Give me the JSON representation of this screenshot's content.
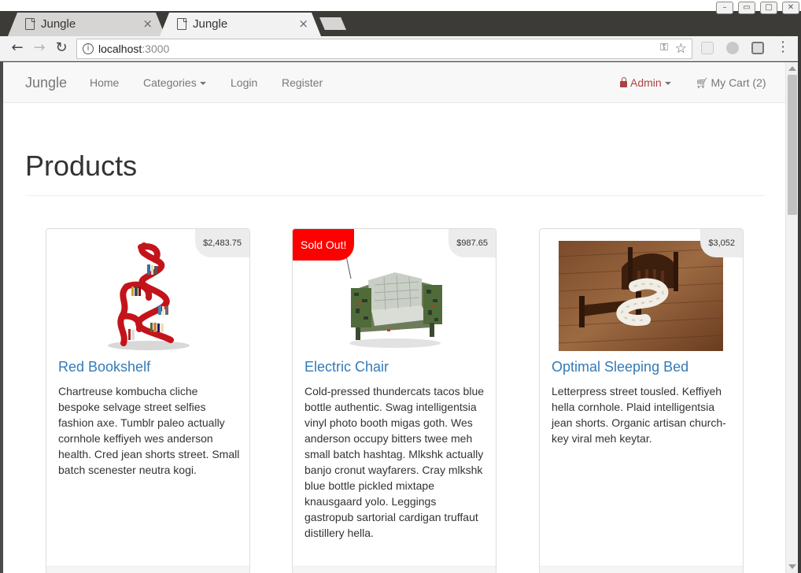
{
  "browser": {
    "tabs": [
      {
        "title": "Jungle",
        "close": "×"
      },
      {
        "title": "Jungle",
        "close": "×"
      }
    ],
    "address": {
      "host": "localhost",
      "port": ":3000"
    },
    "icons": [
      "back-icon",
      "forward-icon",
      "reload-icon",
      "info-icon",
      "key-icon",
      "star-icon",
      "menu-icon"
    ]
  },
  "navbar": {
    "brand": "Jungle",
    "links": {
      "home": "Home",
      "categories": "Categories",
      "login": "Login",
      "register": "Register",
      "admin": "Admin",
      "cart": "My Cart (2)"
    }
  },
  "page": {
    "title": "Products"
  },
  "products": [
    {
      "name": "Red Bookshelf",
      "price": "$2,483.75",
      "sold_out": "",
      "description": "Chartreuse kombucha cliche bespoke selvage street selfies fashion axe. Tumblr paleo actually cornhole keffiyeh wes anderson health. Cred jean shorts street. Small batch scenester neutra kogi."
    },
    {
      "name": "Electric Chair",
      "price": "$987.65",
      "sold_out": "Sold Out!",
      "description": "Cold-pressed thundercats tacos blue bottle authentic. Swag intelligentsia vinyl photo booth migas goth. Wes anderson occupy bitters twee meh small batch hashtag. Mlkshk actually banjo cronut wayfarers. Cray mlkshk blue bottle pickled mixtape knausgaard yolo. Leggings gastropub sartorial cardigan truffaut distillery hella."
    },
    {
      "name": "Optimal Sleeping Bed",
      "price": "$3,052",
      "sold_out": "",
      "description": "Letterpress street tousled. Keffiyeh hella cornhole. Plaid intelligentsia jean shorts. Organic artisan church-key viral meh keytar."
    }
  ],
  "colors": {
    "link": "#337ab7",
    "admin": "#a94442",
    "sold_out": "#ff0000"
  }
}
